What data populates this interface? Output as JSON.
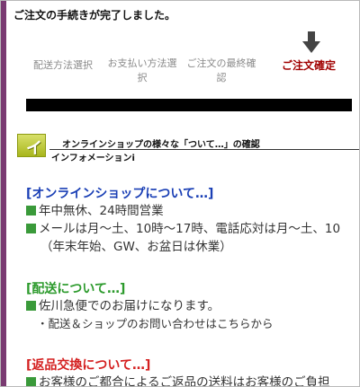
{
  "page": {
    "complete_message": "ご注文の手続きが完了しました。"
  },
  "steps": [
    {
      "label": "配送方法選択"
    },
    {
      "label": "お支払い方法選択"
    },
    {
      "label": "ご注文の最終確認"
    },
    {
      "label": "ご注文確定"
    }
  ],
  "info": {
    "badge_letter": "イ",
    "title": "オンラインショップの様々な「ついて…」の確認",
    "subtitle": "インフォメーションi"
  },
  "sections": {
    "online": {
      "title": "[オンラインショップについて…]",
      "line1": "年中無休、24時間営業",
      "line2": "メールは月～土、10時～17時、電話応対は月～土、10",
      "line3": "（年末年始、GW、お盆日は休業）"
    },
    "shipping": {
      "title": "[配送について…]",
      "line1": "佐川急便でのお届けになります。",
      "line2": "・配送＆ショップのお問い合わせはこちらから"
    },
    "returns": {
      "title": "[返品交換について…]",
      "line1": "お客様のご都合によるご返品の送料はお客様のご負担"
    }
  },
  "colors": {
    "accent_left": "#7a3b72",
    "active_step": "#a00000",
    "blue_title": "#1a3fb5",
    "green_title": "#2c9a2c",
    "red_title": "#d42020",
    "bullet_green": "#3a9a3a"
  },
  "icons": {
    "current_step": "arrow-down-icon",
    "bullet": "square-bullet-icon"
  }
}
